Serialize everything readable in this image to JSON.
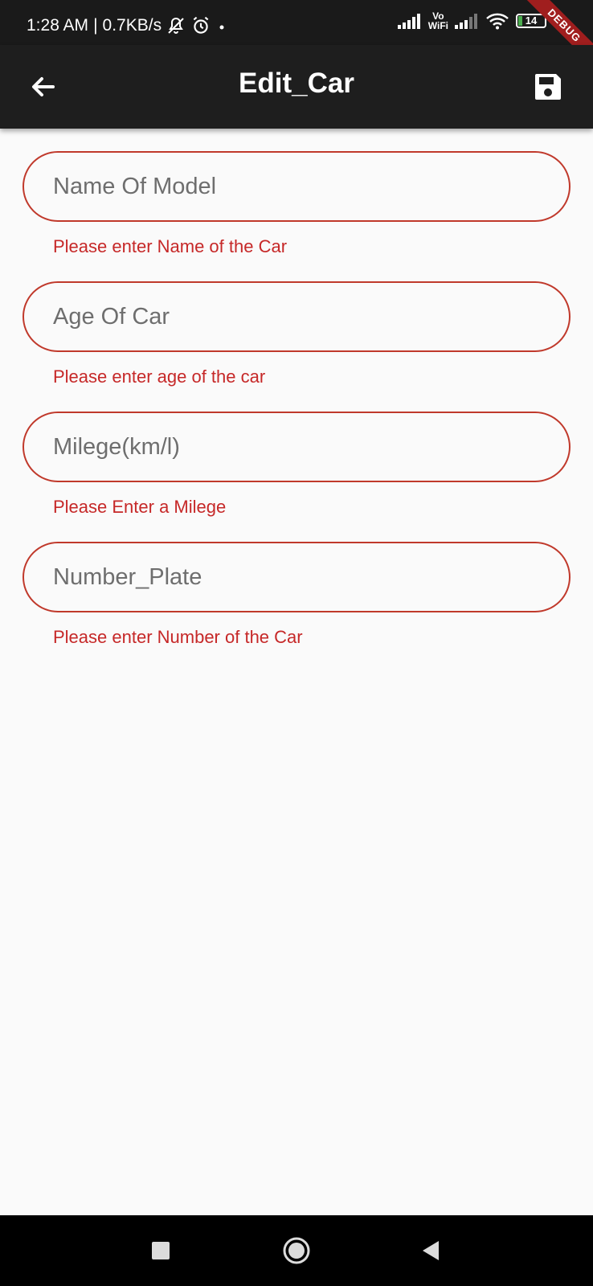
{
  "status_bar": {
    "time": "1:28 AM",
    "separator": "|",
    "net_speed": "0.7KB/s",
    "vowifi_top": "Vo",
    "vowifi_bottom": "WiFi",
    "battery_level": "14",
    "debug_label": "DEBUG",
    "icons": [
      "mute-bell-icon",
      "alarm-icon",
      "dot-icon",
      "signal-icon",
      "signal-icon",
      "wifi-icon",
      "battery-icon",
      "charging-icon"
    ]
  },
  "app_bar": {
    "title": "Edit_Car",
    "back_icon": "arrow-back-icon",
    "save_icon": "save-icon"
  },
  "form": {
    "fields": [
      {
        "placeholder": "Name Of Model",
        "error": "Please enter Name of the Car"
      },
      {
        "placeholder": "Age Of Car",
        "error": "Please enter age of the car"
      },
      {
        "placeholder": "Milege(km/l)",
        "error": "Please Enter a Milege"
      },
      {
        "placeholder": "Number_Plate",
        "error": "Please enter Number of the Car"
      }
    ]
  },
  "nav_bar": {
    "icons": [
      "recents-square-icon",
      "home-circle-icon",
      "back-triangle-icon"
    ]
  },
  "colors": {
    "accent_error": "#c62828",
    "field_border": "#c0392b",
    "app_bar": "#1e1e1e",
    "background": "#fafafa"
  }
}
